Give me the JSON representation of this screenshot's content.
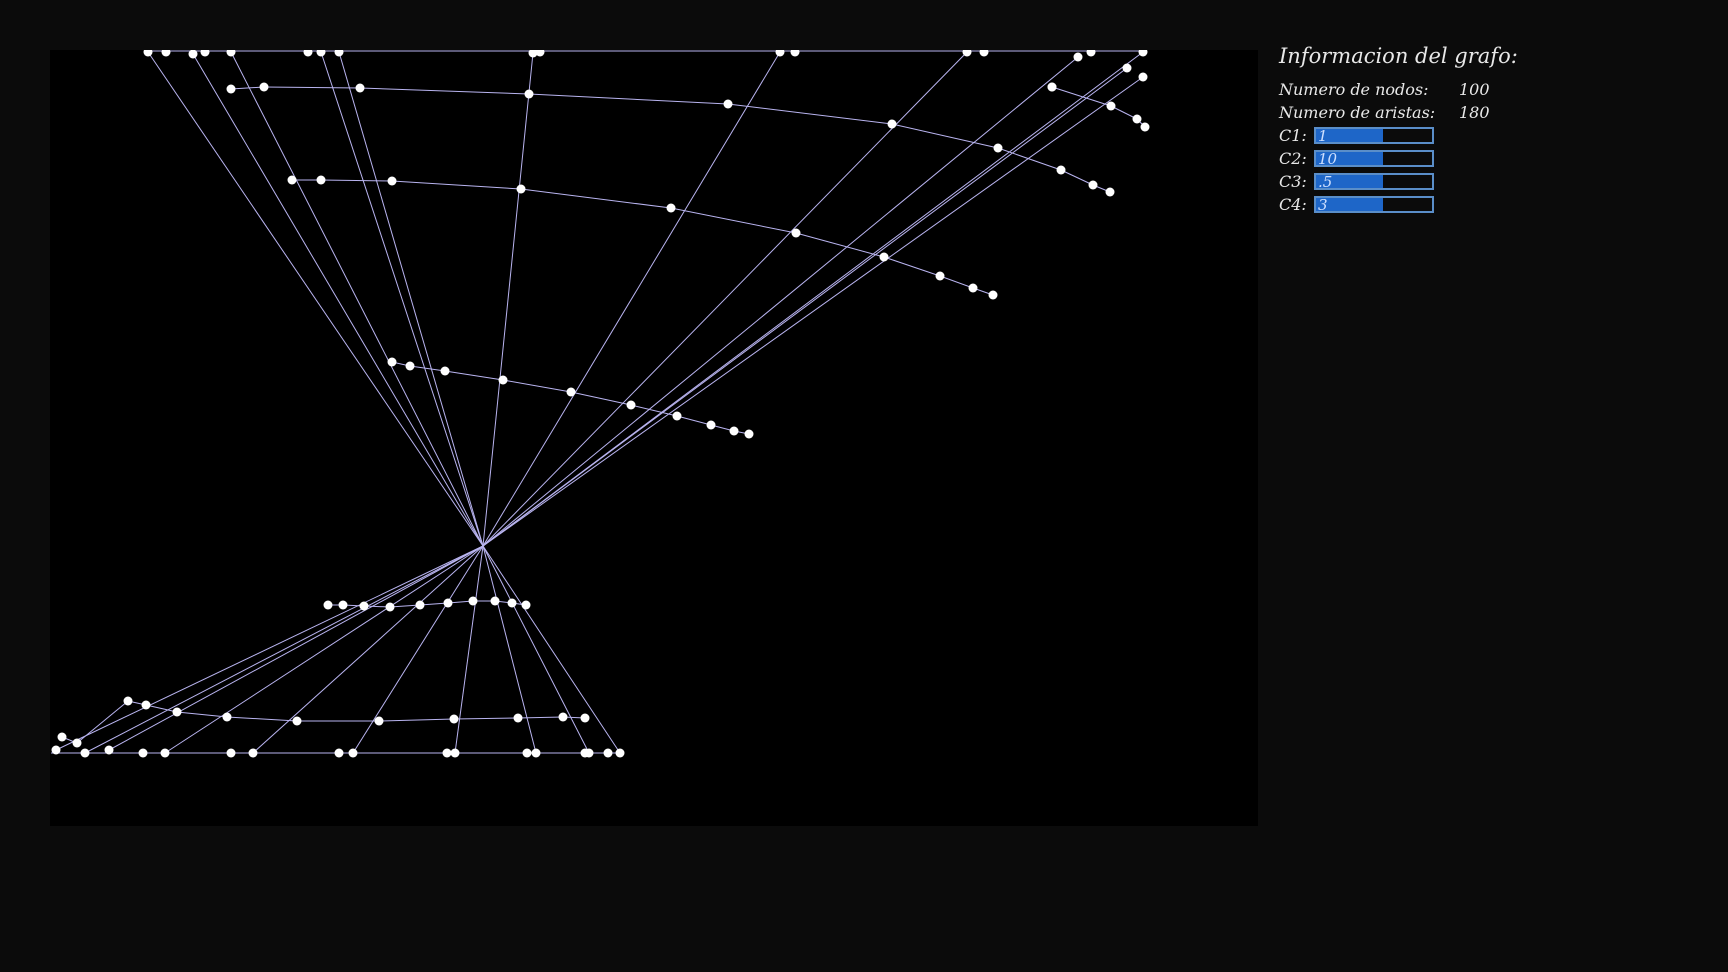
{
  "info": {
    "title": "Informacion del grafo:",
    "nodes_label": "Numero de nodos:",
    "nodes_value": "100",
    "edges_label": "Numero de aristas:",
    "edges_value": "180"
  },
  "params": [
    {
      "label": "C1:",
      "value": "1"
    },
    {
      "label": "C2:",
      "value": "10"
    },
    {
      "label": "C3:",
      "value": ".5"
    },
    {
      "label": "C4:",
      "value": "3"
    }
  ],
  "colors": {
    "background": "#0b0b0b",
    "canvas": "#000000",
    "edge": "#b9b4f0",
    "node": "#ffffff",
    "input_fill": "#1e66c8",
    "input_border": "#5a8ec9"
  }
}
